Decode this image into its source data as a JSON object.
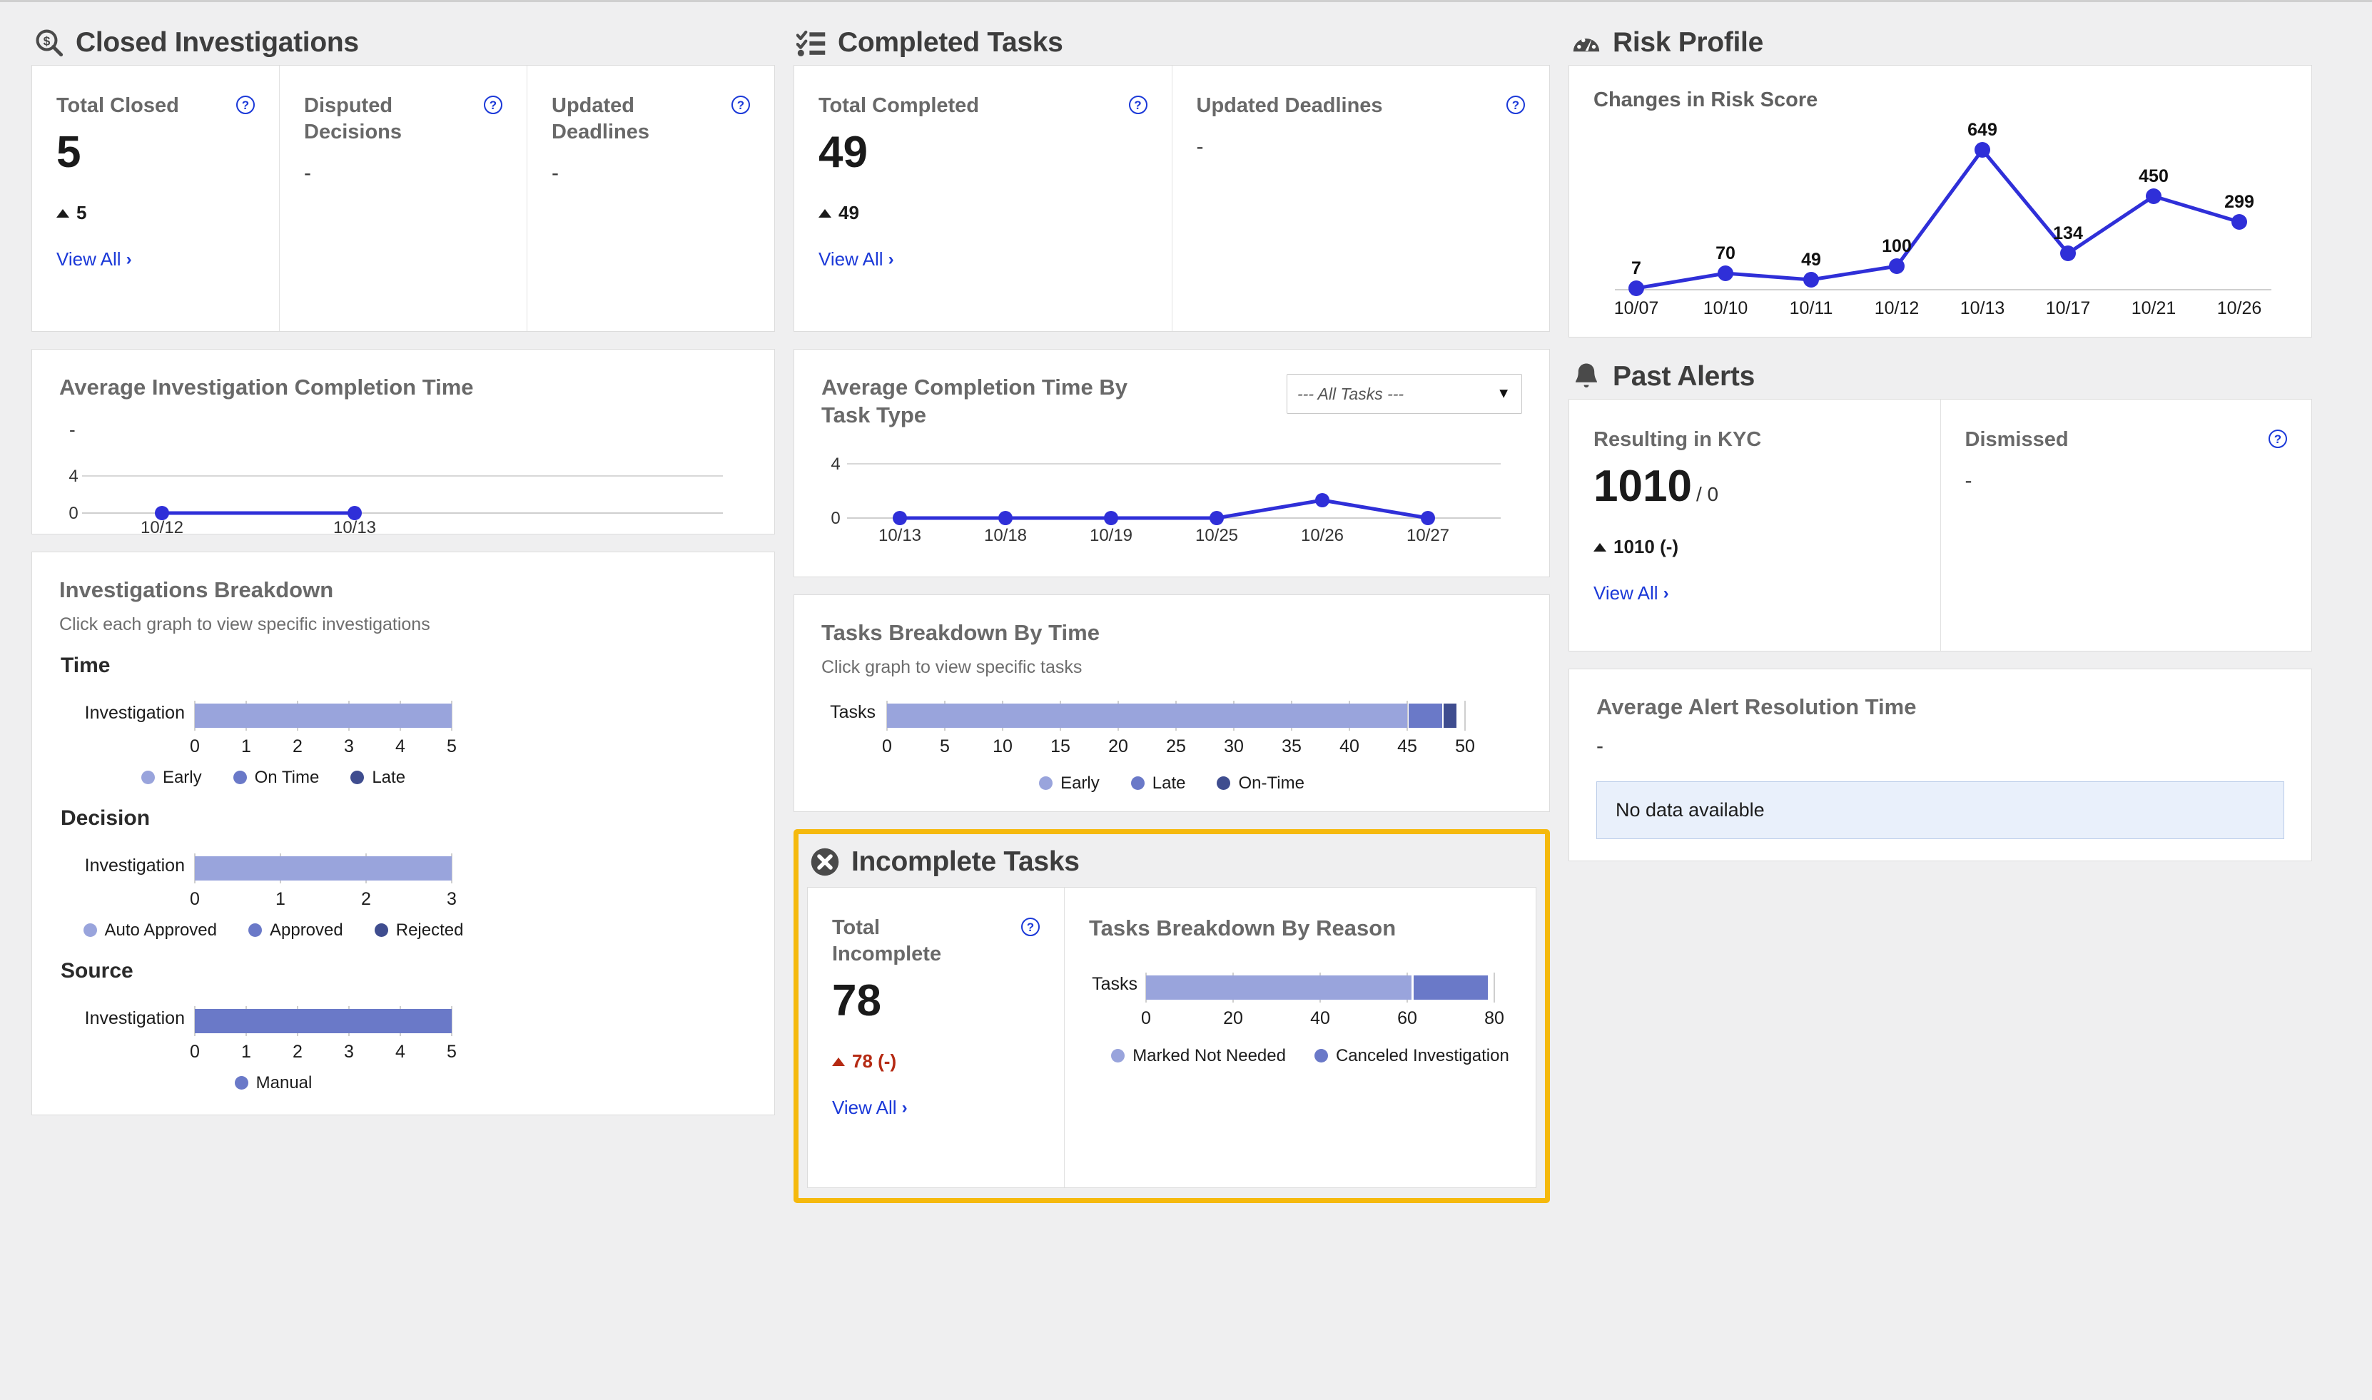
{
  "sections": {
    "closed_investigations": {
      "title": "Closed Investigations",
      "icon": "magnifier-dollar-icon",
      "kpis": [
        {
          "label": "Total Closed",
          "value": "5",
          "delta": "5",
          "view_all": "View All",
          "has_help": true
        },
        {
          "label": "Disputed Decisions",
          "value": "-",
          "has_help": true
        },
        {
          "label": "Updated Deadlines",
          "value": "-",
          "has_help": true
        }
      ],
      "avg_completion": {
        "title": "Average Investigation Completion Time",
        "value_label": "-"
      },
      "breakdown": {
        "title": "Investigations Breakdown",
        "subtitle": "Click each graph to view specific investigations",
        "groups": [
          {
            "name": "Time",
            "legend": [
              "Early",
              "On Time",
              "Late"
            ]
          },
          {
            "name": "Decision",
            "legend": [
              "Auto Approved",
              "Approved",
              "Rejected"
            ]
          },
          {
            "name": "Source",
            "legend": [
              "Manual"
            ]
          }
        ]
      }
    },
    "completed_tasks": {
      "title": "Completed Tasks",
      "icon": "checklist-icon",
      "kpis": [
        {
          "label": "Total Completed",
          "value": "49",
          "delta": "49",
          "view_all": "View All",
          "has_help": true
        },
        {
          "label": "Updated Deadlines",
          "value": "-",
          "has_help": true
        }
      ],
      "avg_completion": {
        "title": "Average Completion Time By Task Type",
        "select_value": "--- All Tasks ---"
      },
      "breakdown": {
        "title": "Tasks Breakdown By Time",
        "subtitle": "Click graph to view specific tasks",
        "legend": [
          "Early",
          "Late",
          "On-Time"
        ]
      }
    },
    "incomplete_tasks": {
      "title": "Incomplete Tasks",
      "icon": "circle-x-icon",
      "kpi": {
        "label": "Total Incomplete",
        "value": "78",
        "delta": "78 (-)",
        "view_all": "View All",
        "has_help": true
      },
      "breakdown": {
        "title": "Tasks Breakdown By Reason",
        "legend": [
          "Marked Not Needed",
          "Canceled Investigation"
        ]
      }
    },
    "risk_profile": {
      "title": "Risk Profile",
      "icon": "gauge-icon",
      "chart_title": "Changes in Risk Score"
    },
    "past_alerts": {
      "title": "Past Alerts",
      "icon": "bell-icon",
      "kpis": [
        {
          "label": "Resulting in KYC",
          "value": "1010",
          "denom": "/ 0",
          "delta": "1010 (-)",
          "view_all": "View All",
          "has_help": false
        },
        {
          "label": "Dismissed",
          "value": "-",
          "has_help": true
        }
      ],
      "resolution": {
        "title": "Average Alert Resolution Time",
        "value_label": "-",
        "no_data": "No data available"
      }
    }
  },
  "colors": {
    "bar_light": "#99a4dc",
    "bar_mid": "#6a79c8",
    "bar_dark": "#3f4d8f",
    "line": "#2f2fd8",
    "link": "#1b39d8",
    "highlight": "#f5b90d",
    "negative": "#b52a13"
  },
  "chart_data": [
    {
      "id": "avg-investigation-completion-time",
      "type": "line",
      "title": "Average Investigation Completion Time",
      "x": [
        "10/12",
        "10/13"
      ],
      "values": [
        0,
        0
      ],
      "ylabel": "",
      "xlabel": "",
      "yticks": [
        0,
        4
      ],
      "ylim": [
        0,
        4
      ],
      "grid": true
    },
    {
      "id": "avg-completion-time-by-task-type",
      "type": "line",
      "title": "Average Completion Time By Task Type",
      "x": [
        "10/13",
        "10/18",
        "10/19",
        "10/25",
        "10/26",
        "10/27"
      ],
      "values": [
        0,
        0,
        0,
        0,
        1.3,
        0
      ],
      "yticks": [
        0,
        4
      ],
      "ylim": [
        0,
        4
      ],
      "xlabel": "",
      "ylabel": "",
      "grid": true
    },
    {
      "id": "investigations-breakdown-time",
      "type": "bar",
      "orientation": "horizontal",
      "title": "Time",
      "categories": [
        "Investigation"
      ],
      "series": [
        {
          "name": "Early",
          "values": [
            5
          ],
          "color": "#99a4dc"
        },
        {
          "name": "On Time",
          "values": [
            0
          ],
          "color": "#6a79c8"
        },
        {
          "name": "Late",
          "values": [
            0
          ],
          "color": "#3f4d8f"
        }
      ],
      "xticks": [
        0,
        1,
        2,
        3,
        4,
        5
      ],
      "xlim": [
        0,
        5
      ],
      "stacked": true
    },
    {
      "id": "investigations-breakdown-decision",
      "type": "bar",
      "orientation": "horizontal",
      "title": "Decision",
      "categories": [
        "Investigation"
      ],
      "series": [
        {
          "name": "Auto Approved",
          "values": [
            3
          ],
          "color": "#99a4dc"
        },
        {
          "name": "Approved",
          "values": [
            0
          ],
          "color": "#6a79c8"
        },
        {
          "name": "Rejected",
          "values": [
            0
          ],
          "color": "#3f4d8f"
        }
      ],
      "xticks": [
        0,
        1,
        2,
        3
      ],
      "xlim": [
        0,
        3
      ],
      "stacked": true
    },
    {
      "id": "investigations-breakdown-source",
      "type": "bar",
      "orientation": "horizontal",
      "title": "Source",
      "categories": [
        "Investigation"
      ],
      "series": [
        {
          "name": "Manual",
          "values": [
            5
          ],
          "color": "#6a79c8"
        }
      ],
      "xticks": [
        0,
        1,
        2,
        3,
        4,
        5
      ],
      "xlim": [
        0,
        5
      ],
      "stacked": true
    },
    {
      "id": "tasks-breakdown-by-time",
      "type": "bar",
      "orientation": "horizontal",
      "title": "Tasks Breakdown By Time",
      "categories": [
        "Tasks"
      ],
      "series": [
        {
          "name": "Early",
          "values": [
            45
          ],
          "color": "#99a4dc"
        },
        {
          "name": "Late",
          "values": [
            3
          ],
          "color": "#6a79c8"
        },
        {
          "name": "On-Time",
          "values": [
            1
          ],
          "color": "#3f4d8f"
        }
      ],
      "xticks": [
        0,
        5,
        10,
        15,
        20,
        25,
        30,
        35,
        40,
        45,
        50
      ],
      "xlim": [
        0,
        50
      ],
      "stacked": true
    },
    {
      "id": "tasks-breakdown-by-reason",
      "type": "bar",
      "orientation": "horizontal",
      "title": "Tasks Breakdown By Reason",
      "categories": [
        "Tasks"
      ],
      "series": [
        {
          "name": "Marked Not Needed",
          "values": [
            61
          ],
          "color": "#99a4dc"
        },
        {
          "name": "Canceled Investigation",
          "values": [
            17
          ],
          "color": "#6a79c8"
        }
      ],
      "xticks": [
        0,
        20,
        40,
        60,
        80
      ],
      "xlim": [
        0,
        80
      ],
      "stacked": true
    },
    {
      "id": "changes-in-risk-score",
      "type": "line",
      "title": "Changes in Risk Score",
      "x": [
        "10/07",
        "10/10",
        "10/11",
        "10/12",
        "10/13",
        "10/17",
        "10/21",
        "10/26"
      ],
      "values": [
        7,
        70,
        49,
        100,
        649,
        134,
        450,
        299
      ],
      "data_labels": [
        "7",
        "70",
        "49",
        "100",
        "649",
        "134",
        "450",
        "299"
      ],
      "ylim": [
        0,
        700
      ],
      "xlabel": "",
      "ylabel": "",
      "grid": false,
      "legend": "none"
    }
  ]
}
